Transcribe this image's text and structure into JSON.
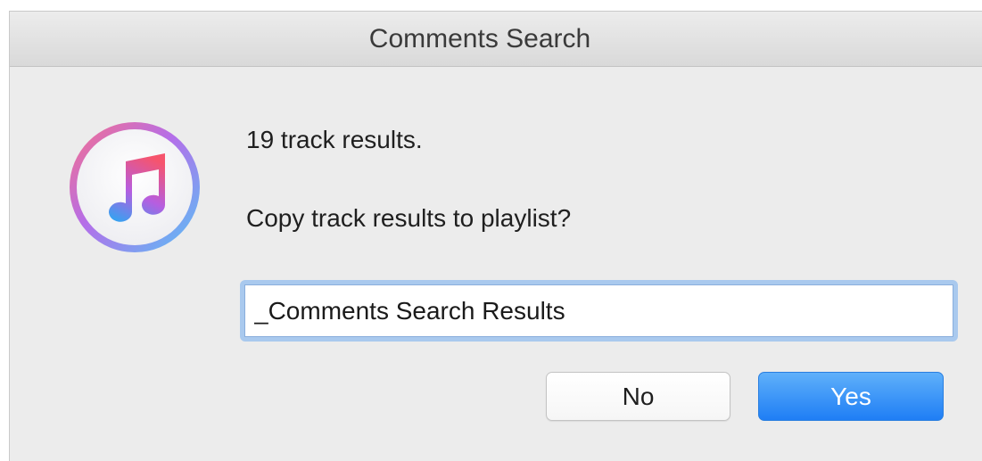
{
  "window": {
    "title": "Comments Search"
  },
  "app_icon": {
    "name": "itunes-icon",
    "ring_colors": [
      "#f45f7b",
      "#b56ce8",
      "#5bb6f5"
    ],
    "note_colors": [
      "#f6546d",
      "#a45ee5",
      "#3aa0f0"
    ]
  },
  "message": {
    "line1": "19 track results.",
    "line2": "Copy track results to playlist?"
  },
  "playlist_input": {
    "value": "_Comments Search Results"
  },
  "buttons": {
    "no_label": "No",
    "yes_label": "Yes"
  },
  "colors": {
    "accent": "#1f7ef5",
    "focus_ring": "#a9c9ee",
    "background": "#ececec"
  }
}
